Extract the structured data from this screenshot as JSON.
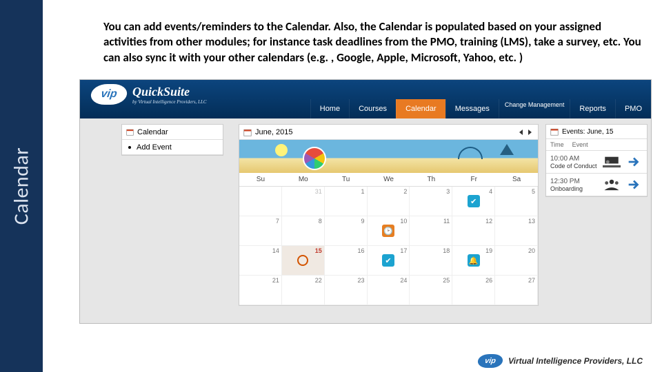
{
  "rail_title": "Calendar",
  "description": "You can add events/reminders to the Calendar. Also, the Calendar is populated based on your assigned activities from other modules; for instance task deadlines from the PMO, training (LMS), take a survey, etc. You can also sync it with your other calendars (e.g. , Google, Apple, Microsoft, Yahoo, etc. )",
  "brand": {
    "logo_text": "vip",
    "suite_title": "QuickSuite",
    "suite_sub": "by Virtual Intelligence Providers, LLC"
  },
  "nav": {
    "items": [
      "Home",
      "Courses",
      "Calendar",
      "Messages",
      "Change Management",
      "Reports",
      "PMO"
    ],
    "active_index": 2
  },
  "sidebar": {
    "heading": "Calendar",
    "add_event": "Add Event"
  },
  "calendar": {
    "title": "June, 2015",
    "weekdays": [
      "Su",
      "Mo",
      "Tu",
      "We",
      "Th",
      "Fr",
      "Sa"
    ],
    "rows": [
      [
        {
          "n": "",
          "dim": true
        },
        {
          "n": "31",
          "dim": true
        },
        {
          "n": "1"
        },
        {
          "n": "2"
        },
        {
          "n": "3"
        },
        {
          "n": "4",
          "ic": "check"
        },
        {
          "n": "5"
        }
      ],
      [
        {
          "n": "7"
        },
        {
          "n": "8"
        },
        {
          "n": "9"
        },
        {
          "n": "10",
          "ic": "clock"
        },
        {
          "n": "11"
        },
        {
          "n": "12"
        },
        {
          "n": "13"
        }
      ],
      [
        {
          "n": "14"
        },
        {
          "n": "15",
          "sel": true,
          "ic": "ring"
        },
        {
          "n": "16"
        },
        {
          "n": "17",
          "ic": "check"
        },
        {
          "n": "18"
        },
        {
          "n": "19",
          "ic": "bell"
        },
        {
          "n": "20"
        }
      ],
      [
        {
          "n": "21"
        },
        {
          "n": "22"
        },
        {
          "n": "23"
        },
        {
          "n": "24"
        },
        {
          "n": "25"
        },
        {
          "n": "26"
        },
        {
          "n": "27"
        }
      ]
    ]
  },
  "events_panel": {
    "title": "Events: June, 15",
    "cols": [
      "Time",
      "Event"
    ],
    "items": [
      {
        "time": "10:00 AM",
        "name": "Code of Conduct"
      },
      {
        "time": "12:30 PM",
        "name": "Onboarding"
      }
    ]
  },
  "footer": "Virtual Intelligence Providers, LLC"
}
